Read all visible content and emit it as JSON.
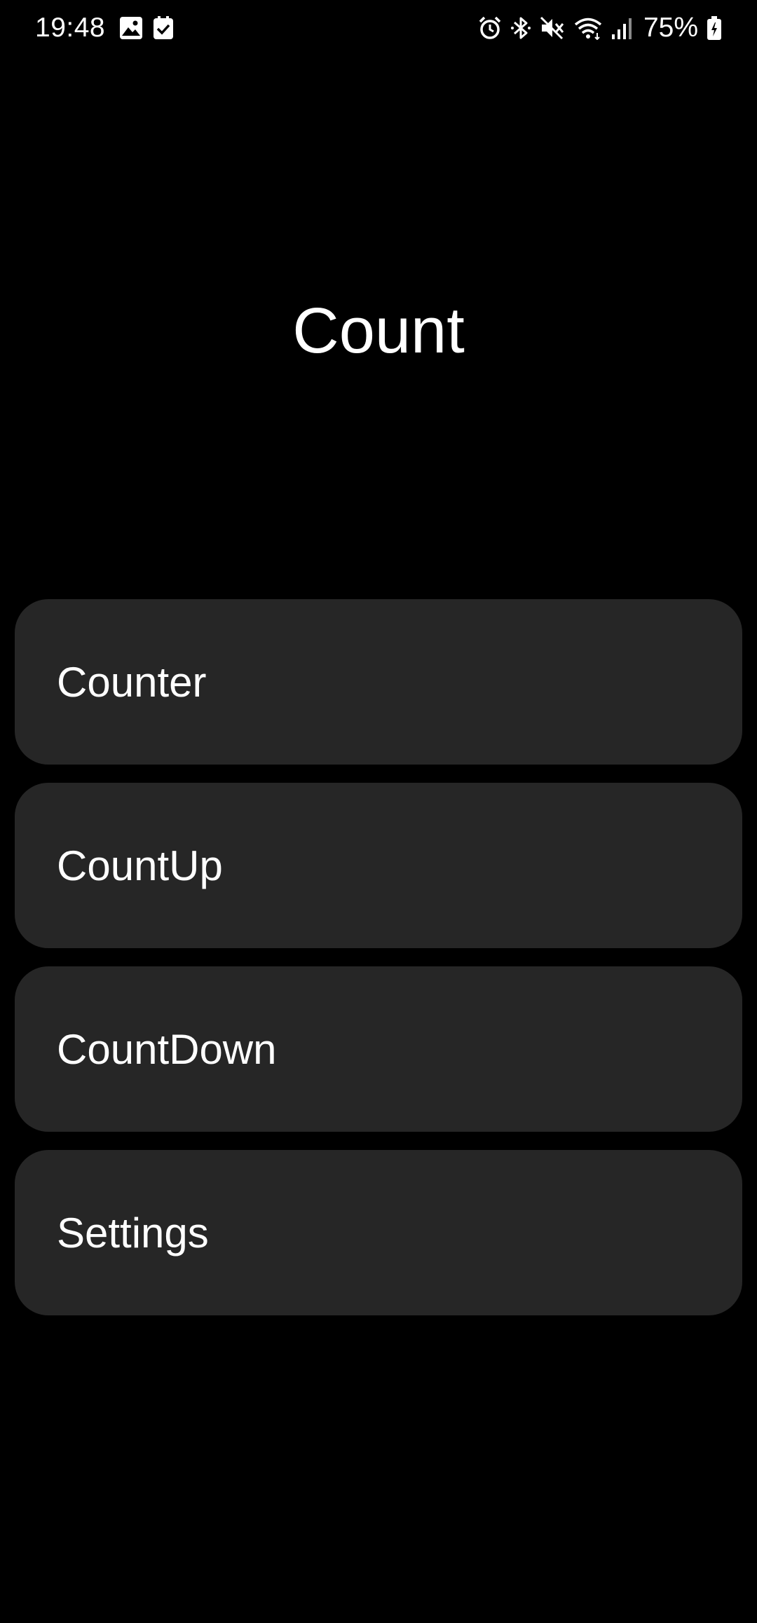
{
  "status_bar": {
    "time": "19:48",
    "battery_percent": "75%",
    "left_icons": [
      "gallery-icon",
      "checkbox-icon"
    ],
    "right_icons": [
      "alarm-icon",
      "bluetooth-icon",
      "mute-icon",
      "wifi-icon",
      "signal-icon",
      "battery-icon"
    ]
  },
  "app": {
    "title": "Count"
  },
  "menu": {
    "items": [
      {
        "label": "Counter"
      },
      {
        "label": "CountUp"
      },
      {
        "label": "CountDown"
      },
      {
        "label": "Settings"
      }
    ]
  },
  "colors": {
    "background": "#000000",
    "card": "#262626",
    "text": "#ffffff"
  }
}
